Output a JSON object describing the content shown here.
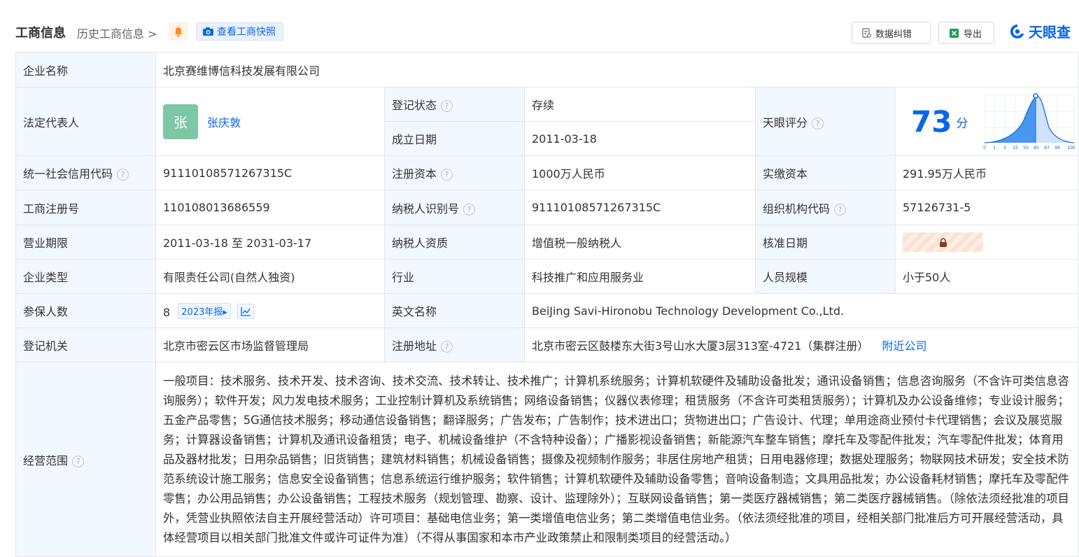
{
  "header": {
    "title": "工商信息",
    "history_link": "历史工商信息",
    "snapshot_button": "查看工商快照",
    "correct_button": "数据纠错",
    "export_button": "导出",
    "brand": "天眼查"
  },
  "rows": {
    "company_name": {
      "label": "企业名称",
      "value": "北京赛维博信科技发展有限公司"
    },
    "legal_rep": {
      "label": "法定代表人",
      "avatar_char": "张",
      "name": "张庆敦"
    },
    "reg_status": {
      "label": "登记状态",
      "value": "存续"
    },
    "founded": {
      "label": "成立日期",
      "value": "2011-03-18"
    },
    "score": {
      "label": "天眼评分",
      "value": "73",
      "unit": "分",
      "ticks": [
        "0",
        "1",
        "3",
        "15",
        "50",
        "85",
        "97",
        "99",
        "100"
      ]
    },
    "credit_code": {
      "label": "统一社会信用代码",
      "value": "91110108571267315C"
    },
    "reg_capital": {
      "label": "注册资本",
      "value": "1000万人民币"
    },
    "paid_capital": {
      "label": "实缴资本",
      "value": "291.95万人民币"
    },
    "biz_reg_no": {
      "label": "工商注册号",
      "value": "110108013686559"
    },
    "taxpayer_id": {
      "label": "纳税人识别号",
      "value": "91110108571267315C"
    },
    "org_code": {
      "label": "组织机构代码",
      "value": "57126731-5"
    },
    "biz_term": {
      "label": "营业期限",
      "value": "2011-03-18 至 2031-03-17"
    },
    "taxpayer_qual": {
      "label": "纳税人资质",
      "value": "增值税一般纳税人"
    },
    "approval_date": {
      "label": "核准日期"
    },
    "company_type": {
      "label": "企业类型",
      "value": "有限责任公司(自然人独资)"
    },
    "industry": {
      "label": "行业",
      "value": "科技推广和应用服务业"
    },
    "staff_size": {
      "label": "人员规模",
      "value": "小于50人"
    },
    "insured": {
      "label": "参保人数",
      "value": "8",
      "report": "2023年报"
    },
    "english_name": {
      "label": "英文名称",
      "value": "BeiJing Savi-Hironobu Technology Development Co.,Ltd."
    },
    "reg_authority": {
      "label": "登记机关",
      "value": "北京市密云区市场监督管理局"
    },
    "reg_address": {
      "label": "注册地址",
      "value": "北京市密云区鼓楼东大街3号山水大厦3层313室-4721（集群注册）",
      "nearby": "附近公司"
    },
    "scope": {
      "label": "经营范围",
      "value": "一般项目：技术服务、技术开发、技术咨询、技术交流、技术转让、技术推广；计算机系统服务；计算机软硬件及辅助设备批发；通讯设备销售；信息咨询服务（不含许可类信息咨询服务）；软件开发；风力发电技术服务；工业控制计算机及系统销售；网络设备销售；仪器仪表修理；租赁服务（不含许可类租赁服务）；计算机及办公设备维修；专业设计服务；五金产品零售；5G通信技术服务；移动通信设备销售；翻译服务；广告发布；广告制作；技术进出口；货物进出口；广告设计、代理；单用途商业预付卡代理销售；会议及展览服务；计算器设备销售；计算机及通讯设备租赁；电子、机械设备维护（不含特种设备）；广播影视设备销售；新能源汽车整车销售；摩托车及零配件批发；汽车零配件批发；体育用品及器材批发；日用杂品销售；旧货销售；建筑材料销售；机械设备销售；摄像及视频制作服务；非居住房地产租赁；日用电器修理；数据处理服务；物联网技术研发；安全技术防范系统设计施工服务；信息安全设备销售；信息系统运行维护服务；软件销售；计算机软硬件及辅助设备零售；音响设备制造；文具用品批发；办公设备耗材销售；摩托车及零配件零售；办公用品销售；办公设备销售；工程技术服务（规划管理、勘察、设计、监理除外）；互联网设备销售；第一类医疗器械销售；第二类医疗器械销售。（除依法须经批准的项目外，凭营业执照依法自主开展经营活动）许可项目：基础电信业务；第一类增值电信业务；第二类增值电信业务。（依法须经批准的项目，经相关部门批准后方可开展经营活动，具体经营项目以相关部门批准文件或许可证件为准）（不得从事国家和本市产业政策禁止和限制类项目的经营活动。）"
    }
  },
  "colors": {
    "accent": "#0a66e8",
    "status": "#1f9d55",
    "label_bg": "#f2f8ff",
    "border": "#e4e6ea"
  }
}
